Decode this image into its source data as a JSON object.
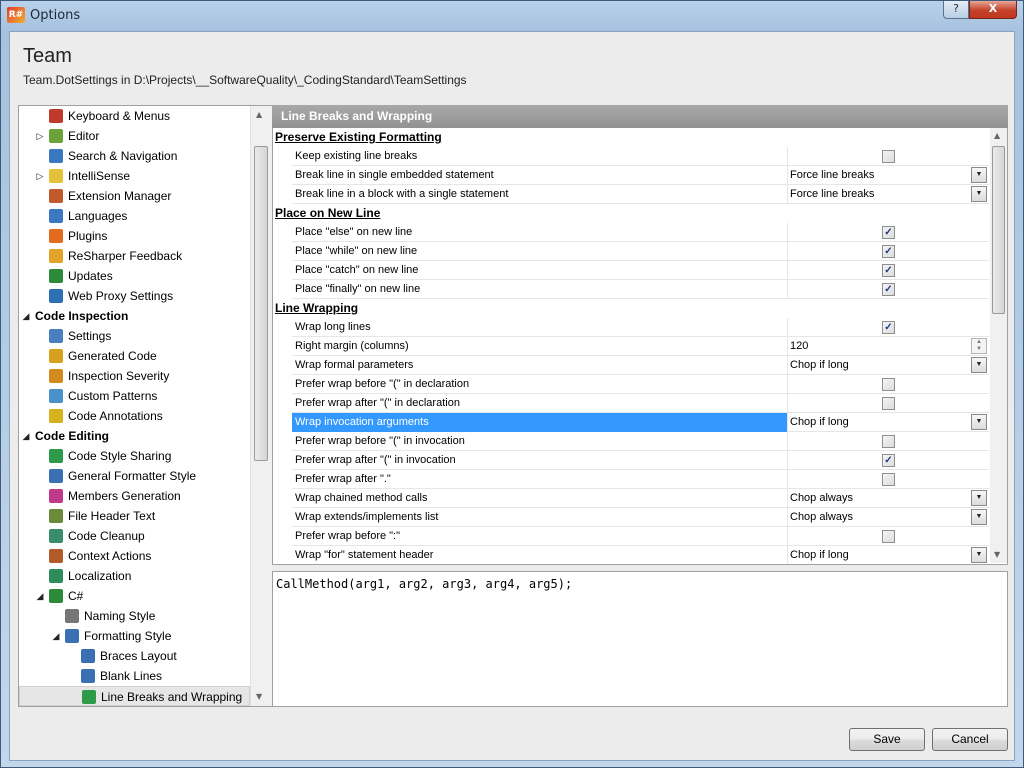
{
  "window": {
    "title": "Options",
    "app_icon_text": "R#",
    "help_label": "?",
    "close_label": "X"
  },
  "header": {
    "title": "Team",
    "subtitle": "Team.DotSettings in D:\\Projects\\__SoftwareQuality\\_CodingStandard\\TeamSettings"
  },
  "tree": {
    "items": [
      {
        "label": "Keyboard & Menus",
        "level": 1,
        "icon": "keyboard-icon",
        "color": "#c0392b",
        "arrow": ""
      },
      {
        "label": "Editor",
        "level": 1,
        "icon": "pencil-icon",
        "color": "#6aa33a",
        "arrow": "▷"
      },
      {
        "label": "Search & Navigation",
        "level": 1,
        "icon": "search-icon",
        "color": "#3a78c2",
        "arrow": ""
      },
      {
        "label": "IntelliSense",
        "level": 1,
        "icon": "lightbulb-icon",
        "color": "#e6c13a",
        "arrow": "▷"
      },
      {
        "label": "Extension Manager",
        "level": 1,
        "icon": "puzzle-icon",
        "color": "#c05a2a",
        "arrow": ""
      },
      {
        "label": "Languages",
        "level": 1,
        "icon": "languages-icon",
        "color": "#3a78c2",
        "arrow": ""
      },
      {
        "label": "Plugins",
        "level": 1,
        "icon": "plugin-icon",
        "color": "#e36b1e",
        "arrow": ""
      },
      {
        "label": "ReSharper Feedback",
        "level": 1,
        "icon": "envelope-icon",
        "color": "#e0a528",
        "arrow": ""
      },
      {
        "label": "Updates",
        "level": 1,
        "icon": "update-icon",
        "color": "#2e8b3a",
        "arrow": ""
      },
      {
        "label": "Web Proxy Settings",
        "level": 1,
        "icon": "globe-icon",
        "color": "#2f6fb3",
        "arrow": ""
      },
      {
        "label": "Code Inspection",
        "level": 0,
        "icon": "",
        "color": "",
        "arrow": "◢",
        "group": true
      },
      {
        "label": "Settings",
        "level": 1,
        "icon": "settings-icon",
        "color": "#4a7fbf",
        "arrow": ""
      },
      {
        "label": "Generated Code",
        "level": 1,
        "icon": "generated-code-icon",
        "color": "#d6a21e",
        "arrow": ""
      },
      {
        "label": "Inspection Severity",
        "level": 1,
        "icon": "severity-icon",
        "color": "#d48a1e",
        "arrow": ""
      },
      {
        "label": "Custom Patterns",
        "level": 1,
        "icon": "patterns-icon",
        "color": "#4a90c9",
        "arrow": ""
      },
      {
        "label": "Code Annotations",
        "level": 1,
        "icon": "annotations-icon",
        "color": "#d6b21e",
        "arrow": ""
      },
      {
        "label": "Code Editing",
        "level": 0,
        "icon": "",
        "color": "",
        "arrow": "◢",
        "group": true
      },
      {
        "label": "Code Style Sharing",
        "level": 1,
        "icon": "sharing-icon",
        "color": "#2e9b4a",
        "arrow": ""
      },
      {
        "label": "General Formatter Style",
        "level": 1,
        "icon": "formatter-icon",
        "color": "#3a6fb3",
        "arrow": ""
      },
      {
        "label": "Members Generation",
        "level": 1,
        "icon": "members-icon",
        "color": "#c0398b",
        "arrow": ""
      },
      {
        "label": "File Header Text",
        "level": 1,
        "icon": "file-header-icon",
        "color": "#6a8c3a",
        "arrow": ""
      },
      {
        "label": "Code Cleanup",
        "level": 1,
        "icon": "cleanup-icon",
        "color": "#3a8c6a",
        "arrow": ""
      },
      {
        "label": "Context Actions",
        "level": 1,
        "icon": "hammer-icon",
        "color": "#b35a2a",
        "arrow": ""
      },
      {
        "label": "Localization",
        "level": 1,
        "icon": "localization-icon",
        "color": "#2e8b5a",
        "arrow": ""
      },
      {
        "label": "C#",
        "level": 1,
        "icon": "csharp-icon",
        "color": "#2e8b3a",
        "arrow": "◢"
      },
      {
        "label": "Naming Style",
        "level": 2,
        "icon": "naming-icon",
        "color": "#777777",
        "arrow": ""
      },
      {
        "label": "Formatting Style",
        "level": 2,
        "icon": "formatting-icon",
        "color": "#3a6fb3",
        "arrow": "◢"
      },
      {
        "label": "Braces Layout",
        "level": 3,
        "icon": "braces-icon",
        "color": "#3a6fb3",
        "arrow": ""
      },
      {
        "label": "Blank Lines",
        "level": 3,
        "icon": "blank-lines-icon",
        "color": "#3a6fb3",
        "arrow": ""
      },
      {
        "label": "Line Breaks and Wrapping",
        "level": 3,
        "icon": "wrapping-icon",
        "color": "#2e9b4a",
        "arrow": "",
        "selected": true
      }
    ]
  },
  "pane": {
    "title": "Line Breaks and Wrapping"
  },
  "grid": {
    "rows": [
      {
        "type": "section",
        "label": "Preserve Existing Formatting"
      },
      {
        "type": "checkbox",
        "label": "Keep existing line breaks",
        "checked": false
      },
      {
        "type": "dropdown",
        "label": "Break line in single embedded statement",
        "value": "Force line breaks"
      },
      {
        "type": "dropdown",
        "label": "Break line in a block with a single statement",
        "value": "Force line breaks"
      },
      {
        "type": "section",
        "label": "Place on New Line"
      },
      {
        "type": "checkbox",
        "label": "Place \"else\" on new line",
        "checked": true
      },
      {
        "type": "checkbox",
        "label": "Place \"while\" on new line",
        "checked": true
      },
      {
        "type": "checkbox",
        "label": "Place \"catch\" on new line",
        "checked": true
      },
      {
        "type": "checkbox",
        "label": "Place \"finally\" on new line",
        "checked": true
      },
      {
        "type": "section",
        "label": "Line Wrapping"
      },
      {
        "type": "checkbox",
        "label": "Wrap long lines",
        "checked": true
      },
      {
        "type": "spinner",
        "label": "Right margin (columns)",
        "value": "120"
      },
      {
        "type": "dropdown",
        "label": "Wrap formal parameters",
        "value": "Chop if long"
      },
      {
        "type": "checkbox",
        "label": "Prefer wrap before \"(\" in declaration",
        "checked": false
      },
      {
        "type": "checkbox",
        "label": "Prefer wrap after \"(\" in declaration",
        "checked": false
      },
      {
        "type": "dropdown",
        "label": "Wrap invocation arguments",
        "value": "Chop if long",
        "highlight": true
      },
      {
        "type": "checkbox",
        "label": "Prefer wrap before \"(\" in invocation",
        "checked": false
      },
      {
        "type": "checkbox",
        "label": "Prefer wrap after \"(\" in invocation",
        "checked": true
      },
      {
        "type": "checkbox",
        "label": "Prefer wrap after \".\"",
        "checked": false
      },
      {
        "type": "dropdown",
        "label": "Wrap chained method calls",
        "value": "Chop always"
      },
      {
        "type": "dropdown",
        "label": "Wrap extends/implements list",
        "value": "Chop always"
      },
      {
        "type": "checkbox",
        "label": "Prefer wrap before \":\"",
        "checked": false
      },
      {
        "type": "dropdown",
        "label": "Wrap \"for\" statement header",
        "value": "Chop if long"
      }
    ]
  },
  "preview": {
    "code": "CallMethod(arg1, arg2, arg3, arg4, arg5);"
  },
  "footer": {
    "save_label": "Save",
    "cancel_label": "Cancel"
  },
  "colors": {
    "selection": "#3399ff",
    "pane_header": "#999999",
    "check": "#21368c"
  }
}
